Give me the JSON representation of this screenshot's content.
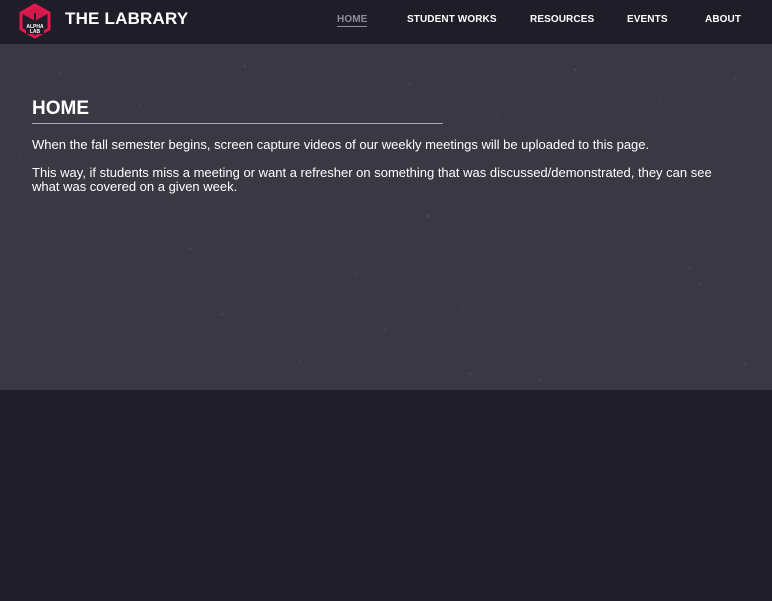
{
  "brand": {
    "logo_text_line1": "ALPHA",
    "logo_text_line2": "LAB",
    "title": "THE LABRARY",
    "accent_color": "#e0194e"
  },
  "nav": {
    "items": [
      {
        "label": "HOME",
        "active": true
      },
      {
        "label": "STUDENT WORKS",
        "active": false
      },
      {
        "label": "RESOURCES",
        "active": false
      },
      {
        "label": "EVENTS",
        "active": false
      },
      {
        "label": "ABOUT",
        "active": false
      }
    ]
  },
  "main": {
    "heading": "HOME",
    "paragraphs": [
      "When the fall semester begins, screen capture videos of our weekly meetings will be uploaded to this page.",
      "This way, if students miss a meeting or want a refresher on something that was discussed/demonstrated, they can see what was covered on a given week."
    ]
  },
  "colors": {
    "header_bg": "#1f1e28",
    "hero_bg": "#393843",
    "page_bg": "#201f29",
    "nav_active": "#8e8d98"
  }
}
